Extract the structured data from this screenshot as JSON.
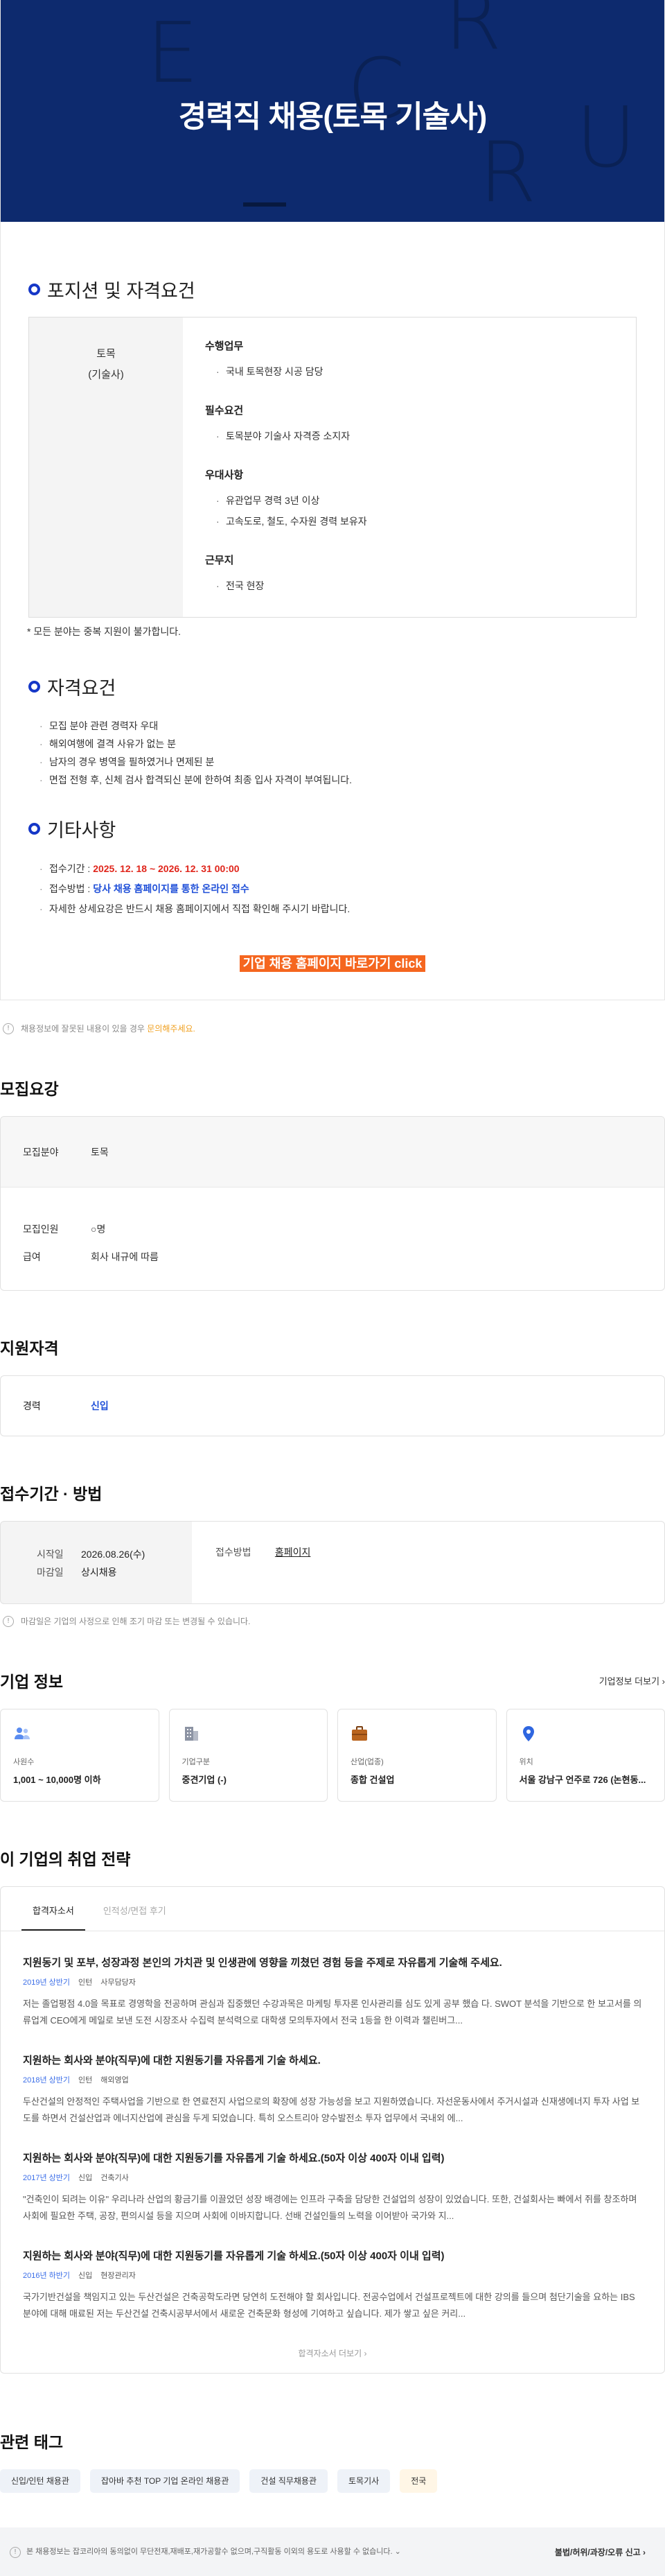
{
  "banner": {
    "title": "경력직 채용(토목 기술사)",
    "letters": [
      "E",
      "C",
      "R",
      "R",
      "U"
    ]
  },
  "position": {
    "section_title": "포지션 및 자격요건",
    "role": [
      "토목",
      "(기술사)"
    ],
    "groups": [
      {
        "title": "수행업무",
        "items": [
          "국내 토목현장 시공 담당"
        ]
      },
      {
        "title": "필수요건",
        "items": [
          "토목분야 기술사 자격증 소지자"
        ]
      },
      {
        "title": "우대사항",
        "items": [
          "유관업무 경력 3년 이상",
          "고속도로, 철도, 수자원 경력 보유자"
        ]
      },
      {
        "title": "근무지",
        "items": [
          "전국 현장"
        ]
      }
    ],
    "note": "* 모든 분야는 중복 지원이 불가합니다."
  },
  "qualifications": {
    "section_title": "자격요건",
    "items": [
      "모집 분야 관련 경력자 우대",
      "해외여행에 결격 사유가 없는 분",
      "남자의 경우 병역을 필하였거나 면제된 분",
      "면접 전형 후, 신체 검사 합격되신 분에 한하여 최종 입사 자격이 부여됩니다."
    ]
  },
  "etc": {
    "section_title": "기타사항",
    "period_label": "접수기간 : ",
    "period_value": "2025. 12. 18 ~ 2026. 12. 31 00:00",
    "method_label": "접수방법 : ",
    "method_value": "당사 채용 홈페이지를 통한 온라인 접수",
    "detail": "자세한 상세요강은 반드시 채용 홈페이지에서 직접 확인해 주시기 바랍니다."
  },
  "cta": "기업 채용 홈페이지 바로가기 click",
  "report": {
    "text": "채용정보에 잘못된 내용이 있을 경우 ",
    "link": "문의해주세요."
  },
  "recruit": {
    "title": "모집요강",
    "field_k": "모집분야",
    "field_v": "토목",
    "count_k": "모집인원",
    "count_v": "○명",
    "salary_k": "급여",
    "salary_v": "회사 내규에 따름"
  },
  "qualify": {
    "title": "지원자격",
    "k": "경력",
    "v": "신입"
  },
  "apply": {
    "title": "접수기간 · 방법",
    "start_k": "시작일",
    "start_v": "2026.08.26(수)",
    "end_k": "마감일",
    "end_v": "상시채용",
    "method_k": "접수방법",
    "method_v": "홈페이지",
    "note": "마감일은 기업의 사정으로 인해 조기 마감 또는 변경될 수 있습니다."
  },
  "company": {
    "title": "기업 정보",
    "more": "기업정보 더보기 ›",
    "cards": [
      {
        "label": "사원수",
        "value": "1,001 ~ 10,000명 이하",
        "icon": "people-icon",
        "color": "#5a8cf0"
      },
      {
        "label": "기업구분",
        "value": "중견기업 (-)",
        "icon": "building-icon",
        "color": "#8c93a3"
      },
      {
        "label": "산업(업종)",
        "value": "종합 건설업",
        "icon": "briefcase-icon",
        "color": "#b9641e"
      },
      {
        "label": "위치",
        "value": "서울 강남구 언주로 726 (논현동...",
        "icon": "pin-icon",
        "color": "#2f66e0"
      }
    ]
  },
  "strategy": {
    "title": "이 기업의 취업 전략",
    "tabs": [
      "합격자소서",
      "인적성/면접 후기"
    ],
    "essays": [
      {
        "q": "지원동기 및 포부, 성장과정 본인의 가치관 및 인생관에 영향을 끼쳤던 경험 등을 주제로 자유롭게 기술해 주세요.",
        "year": "2019년 상반기",
        "type": "인턴",
        "dept": "사무담당자",
        "body": "저는 졸업평점 4.0을 목표로 경영학을 전공하며 관심과 집중했던 수강과목은 마케팅 투자론 인사관리를 심도 있게 공부 했습 다. SWOT 분석을 기반으로 한 보고서를 의류업계 CEO에게 메일로 보낸 도전 시장조사 수집력 분석력으로 대학생 모의투자에서 전국 1등을 한 이력과 챌린버그..."
      },
      {
        "q": "지원하는 회사와 분야(직무)에 대한 지원동기를 자유롭게 기술 하세요.",
        "year": "2018년 상반기",
        "type": "인턴",
        "dept": "해외영업",
        "body": "두산건설의 안정적인 주택사업을 기반으로 한 연료전지 사업으로의 확장에 성장 가능성을 보고 지원하였습니다. 자선운동사에서 주거시설과 신재생에너지 투자 사업 보도를 하면서 건설산업과 에너지산업에 관심을 두게 되었습니다. 특히 오스트리아 양수발전소 투자 업무에서 국내외 에..."
      },
      {
        "q": "지원하는 회사와 분야(직무)에 대한 지원동기를 자유롭게 기술 하세요.(50자 이상 400자 이내 입력)",
        "year": "2017년 상반기",
        "type": "신입",
        "dept": "건축기사",
        "body": "\"건축인이 되려는 이유\" 우리나라 산업의 황금기를 이끌었던 성장 배경에는 인프라 구축을 담당한 건설업의 성장이 있었습니다. 또한, 건설회사는 빠에서 쥐를 창조하며 사회에 필요한 주택, 공장, 편의시설 등을 지으며 사회에 이바지합니다. 선배 건설인들의 노력을 이어받아 국가와 지..."
      },
      {
        "q": "지원하는 회사와 분야(직무)에 대한 지원동기를 자유롭게 기술 하세요.(50자 이상 400자 이내 입력)",
        "year": "2016년 하반기",
        "type": "신입",
        "dept": "현장관리자",
        "body": "국가기반건설을 책임지고 있는 두산건설은 건축공학도라면 당연히 도전해야 할 회사입니다. 전공수업에서 건설프로젝트에 대한 강의를 들으며 첨단기술을 요하는 IBS분야에 대해 매료된 저는 두산건설 건축시공부서에서 새로운 건축문화 형성에 기여하고 싶습니다. 제가 쌓고 싶은 커리..."
      }
    ],
    "more": "합격자소서 더보기 ›"
  },
  "tags": {
    "title": "관련 태그",
    "items": [
      "신입/인턴 채용관",
      "잡아바 추천 TOP 기업 온라인 채용관",
      "건설 직무채용관",
      "토목기사",
      "전국"
    ]
  },
  "footer": {
    "notice": "본 채용정보는 잡코리아의 동의없이 무단전재,재배포,재가공할수 없으며,구직활동 이외의 용도로 사용할 수 없습니다. ⌄",
    "right": "불법/허위/과장/오류 신고 ›"
  }
}
